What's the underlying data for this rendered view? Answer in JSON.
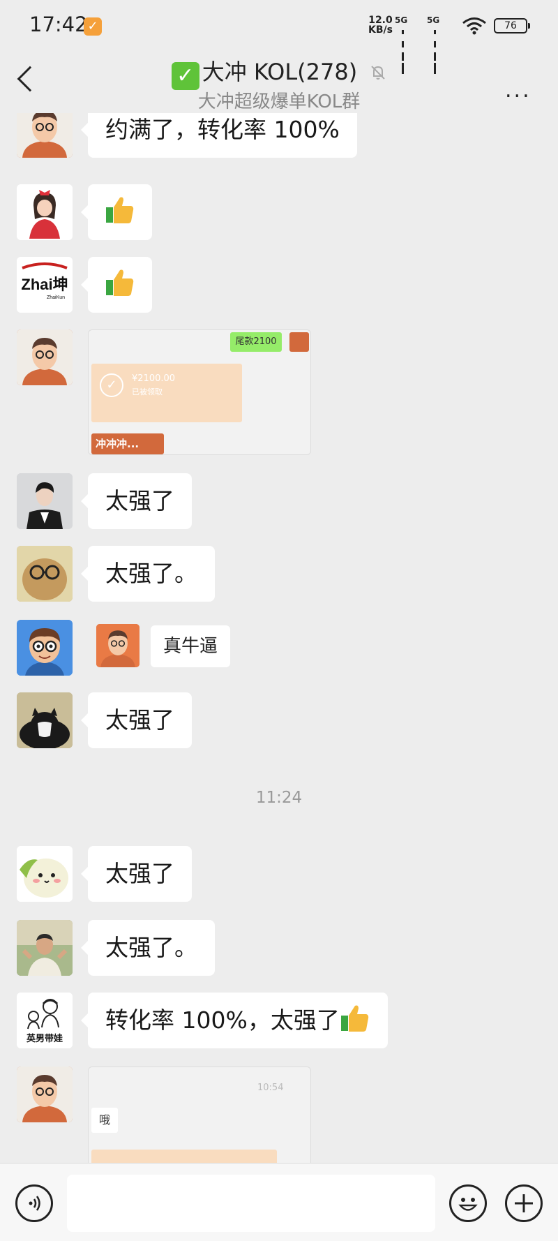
{
  "status": {
    "time": "17:42",
    "net_speed_value": "12.0",
    "net_speed_unit": "KB/s",
    "sim1": "5G",
    "sim2": "5G",
    "battery": "76"
  },
  "header": {
    "title": "大冲 KOL(278)",
    "title_emoji": "✅",
    "subtitle": "大冲超级爆单KOL群",
    "more": "..."
  },
  "messages": [
    {
      "text": "约满了，转化率 100%"
    },
    {
      "text": ""
    },
    {
      "text": ""
    },
    {
      "image_label": "尾款2100",
      "image_amount": "¥2100.00",
      "image_status": "已被领取",
      "image_caption": "冲冲冲..."
    },
    {
      "text": "太强了"
    },
    {
      "text": "太强了。"
    },
    {
      "text": "真牛逼"
    },
    {
      "text": "太强了"
    },
    {
      "text": "太强了"
    },
    {
      "text": "太强了。"
    },
    {
      "text": "转化率 100%，太强了"
    },
    {
      "image_time": "10:54",
      "image_text": "哦"
    }
  ],
  "timestamp": "11:24",
  "avatars": {
    "zhaikun_logo": "Zhai坤",
    "zhaikun_sub": "ZhaiKun",
    "yingnan_label": "英男带娃"
  },
  "colors": {
    "background": "#ededed",
    "bubble": "#ffffff",
    "accent_green": "#5fc339",
    "avatar_orange": "#d2693c"
  }
}
